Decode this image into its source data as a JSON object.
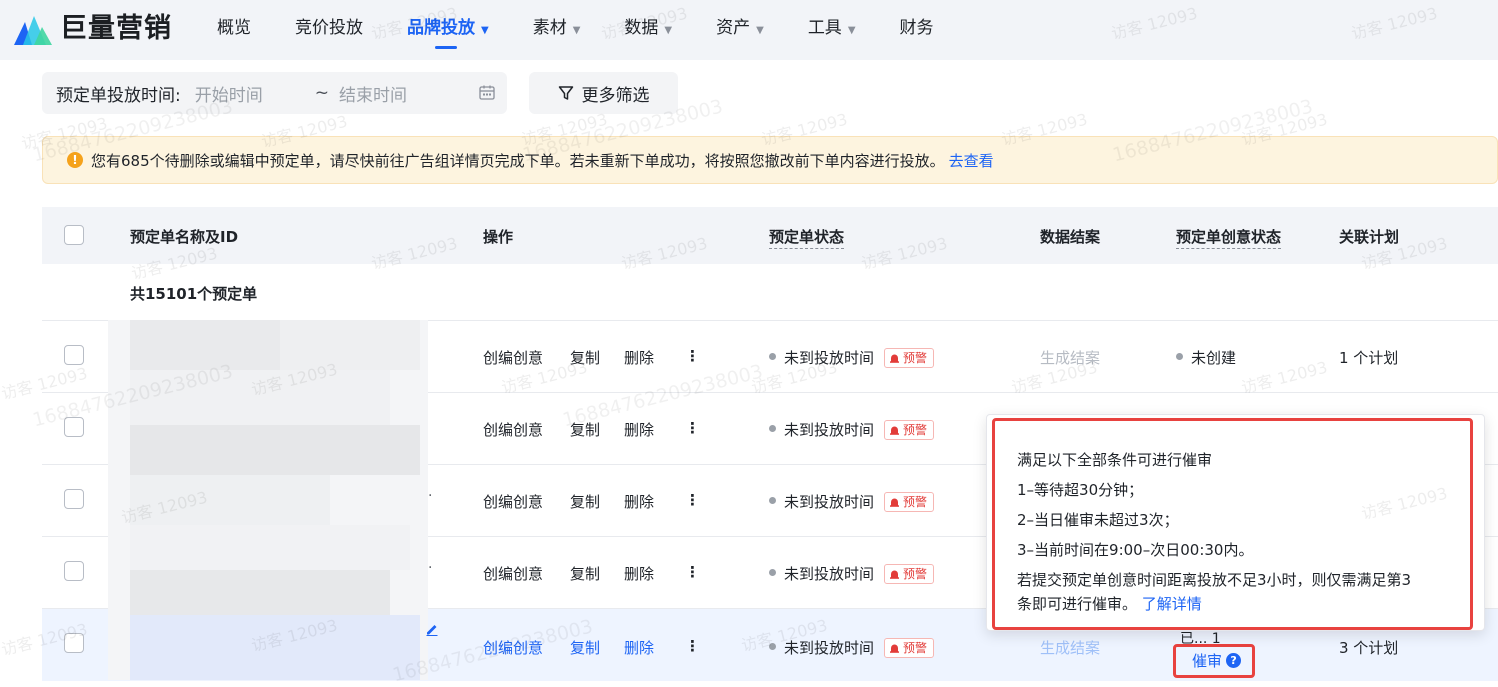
{
  "brand": {
    "name": "巨量营销"
  },
  "nav": {
    "items": [
      {
        "label": "概览",
        "has_dropdown": false,
        "active": false
      },
      {
        "label": "竞价投放",
        "has_dropdown": false,
        "active": false
      },
      {
        "label": "品牌投放",
        "has_dropdown": true,
        "active": true
      },
      {
        "label": "素材",
        "has_dropdown": true,
        "active": false
      },
      {
        "label": "数据",
        "has_dropdown": true,
        "active": false
      },
      {
        "label": "资产",
        "has_dropdown": true,
        "active": false
      },
      {
        "label": "工具",
        "has_dropdown": true,
        "active": false
      },
      {
        "label": "财务",
        "has_dropdown": false,
        "active": false
      }
    ],
    "caret": "▼"
  },
  "filter": {
    "label": "预定单投放时间:",
    "start_placeholder": "开始时间",
    "tilde": "~",
    "end_placeholder": "结束时间",
    "more_filter": "更多筛选"
  },
  "notice": {
    "icon": "!",
    "text": "您有685个待删除或编辑中预定单，请尽快前往广告组详情页完成下单。若未重新下单成功，将按照您撤改前下单内容进行投放。",
    "link": "去查看"
  },
  "table": {
    "headers": {
      "name": "预定单名称及ID",
      "actions": "操作",
      "status": "预定单状态",
      "settlement": "数据结案",
      "creative_status": "预定单创意状态",
      "plan": "关联计划"
    },
    "total": "共15101个预定单",
    "rows": [
      {
        "actions": [
          "创编创意",
          "复制",
          "删除"
        ],
        "status": "未到投放时间",
        "badge": "预警",
        "settlement": "生成结案",
        "creative_status": "未创建",
        "plan": "1 个计划"
      },
      {
        "actions": [
          "创编创意",
          "复制",
          "删除"
        ],
        "status": "未到投放时间",
        "badge": "预警"
      },
      {
        "actions": [
          "创编创意",
          "复制",
          "删除"
        ],
        "status": "未到投放时间",
        "badge": "预警"
      },
      {
        "actions": [
          "创编创意",
          "复制",
          "删除"
        ],
        "status": "未到投放时间",
        "badge": "预警"
      },
      {
        "actions": [
          "创编创意",
          "复制",
          "删除"
        ],
        "status": "未到投放时间",
        "badge": "预警",
        "settlement": "生成结案",
        "creative_status_partial": "已... 1",
        "urge": "催审",
        "plan": "3 个计划"
      }
    ],
    "more_icon": "⋮",
    "ellipsis_fragment": "."
  },
  "tooltip": {
    "title": "满足以下全部条件可进行催审",
    "line1": "1–等待超30分钟；",
    "line2": "2–当日催审未超过3次；",
    "line3": "3–当前时间在9:00–次日00:30内。",
    "note_line1": "若提交预定单创意时间距离投放不足3小时，则仅需满足第3",
    "note_line2": "条即可进行催审。",
    "link": "了解详情"
  },
  "help_icon": "?",
  "watermark": {
    "text": "访客 12093",
    "digits": "16884762209238003"
  },
  "colors": {
    "accent": "#1d64f4",
    "warning": "#f5a21b",
    "alert": "#e23c39",
    "highlight_frame": "#e8423f"
  }
}
